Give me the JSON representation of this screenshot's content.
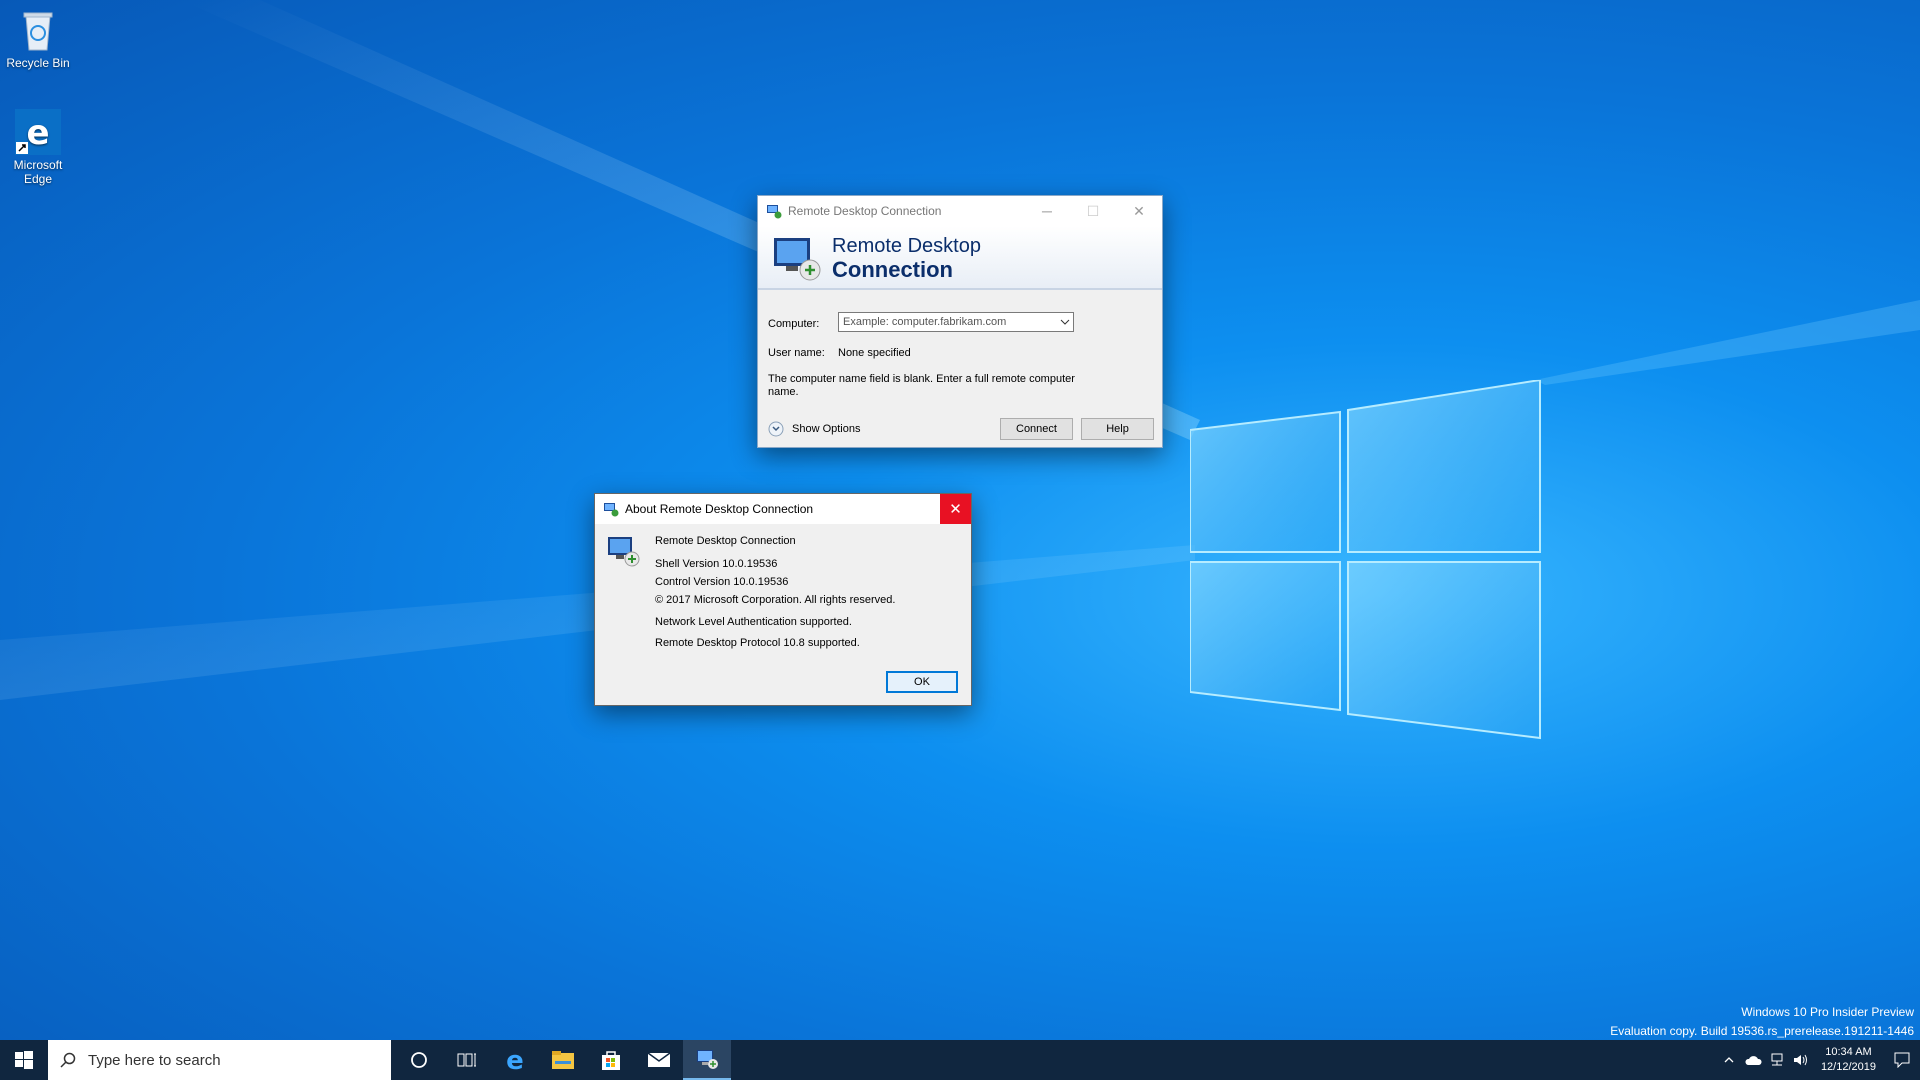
{
  "desktop": {
    "icons": [
      {
        "label": "Recycle Bin",
        "icon": "recycle-bin-icon"
      },
      {
        "label": "Microsoft Edge",
        "icon": "edge-icon"
      }
    ]
  },
  "rdc_window": {
    "title": "Remote Desktop Connection",
    "banner_line1": "Remote Desktop",
    "banner_line2": "Connection",
    "computer_label": "Computer:",
    "computer_placeholder": "Example: computer.fabrikam.com",
    "username_label": "User name:",
    "username_value": "None specified",
    "message_line1": "The computer name field is blank.  Enter a full remote computer",
    "message_line2": "name.",
    "show_options_label": "Show Options",
    "connect_label": "Connect",
    "help_label": "Help",
    "minimize_glyph": "─",
    "maximize_glyph": "☐",
    "close_glyph": "✕"
  },
  "about_dialog": {
    "title": "About Remote Desktop Connection",
    "product": "Remote Desktop Connection",
    "shell_version": "Shell Version 10.0.19536",
    "control_version": "Control Version 10.0.19536",
    "copyright": "© 2017 Microsoft Corporation. All rights reserved.",
    "nla": "Network Level Authentication supported.",
    "protocol": "Remote Desktop Protocol 10.8 supported.",
    "ok_label": "OK",
    "close_glyph": "✕"
  },
  "watermark": {
    "line1": "Windows 10 Pro Insider Preview",
    "line2": "Evaluation copy. Build 19536.rs_prerelease.191211-1446"
  },
  "taskbar": {
    "search_placeholder": "Type here to search",
    "pinned": [
      "cortana-icon",
      "task-view-icon",
      "edge-icon",
      "file-explorer-icon",
      "store-icon",
      "mail-icon",
      "remote-desktop-icon"
    ],
    "clock_time": "10:34 AM",
    "clock_date": "12/12/2019"
  },
  "colors": {
    "accent": "#0078d7",
    "close_red": "#e81123",
    "taskbar": "#10263f"
  }
}
